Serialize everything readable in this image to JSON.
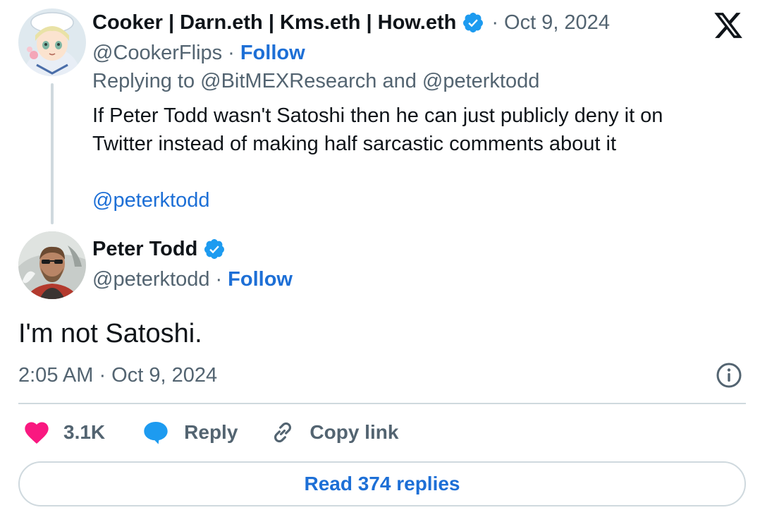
{
  "colors": {
    "accent": "#1d6fd6",
    "verified": "#1d9bf0",
    "like": "#f91880",
    "muted_text": "#536471",
    "primary_text": "#0f1419",
    "divider": "#cfd9de"
  },
  "brand": {
    "icon": "x-logo-icon"
  },
  "reply_tweet": {
    "display_name": "Cooker | Darn.eth | Kms.eth | How.eth",
    "verified_icon": "verified-badge-icon",
    "separator": "·",
    "date": "Oct 9, 2024",
    "handle": "@CookerFlips",
    "follow_label": "Follow",
    "replying_to": "Replying to @BitMEXResearch and @peterktodd",
    "text": "If Peter Todd wasn't Satoshi then he can just publicly deny it on Twitter instead of making half sarcastic comments about it",
    "mention": "@peterktodd",
    "avatar_icon": "cartoon-avatar-icon"
  },
  "main_tweet": {
    "display_name": "Peter Todd",
    "verified_icon": "verified-badge-icon",
    "handle": "@peterktodd",
    "separator": "·",
    "follow_label": "Follow",
    "text": "I'm not Satoshi.",
    "timestamp": "2:05 AM · Oct 9, 2024",
    "info_icon": "info-icon",
    "avatar_icon": "photo-avatar-icon"
  },
  "actions": {
    "like": {
      "icon": "heart-icon",
      "count": "3.1K"
    },
    "reply": {
      "icon": "speech-bubble-icon",
      "label": "Reply"
    },
    "copy": {
      "icon": "link-icon",
      "label": "Copy link"
    }
  },
  "read_replies_label": "Read 374 replies"
}
